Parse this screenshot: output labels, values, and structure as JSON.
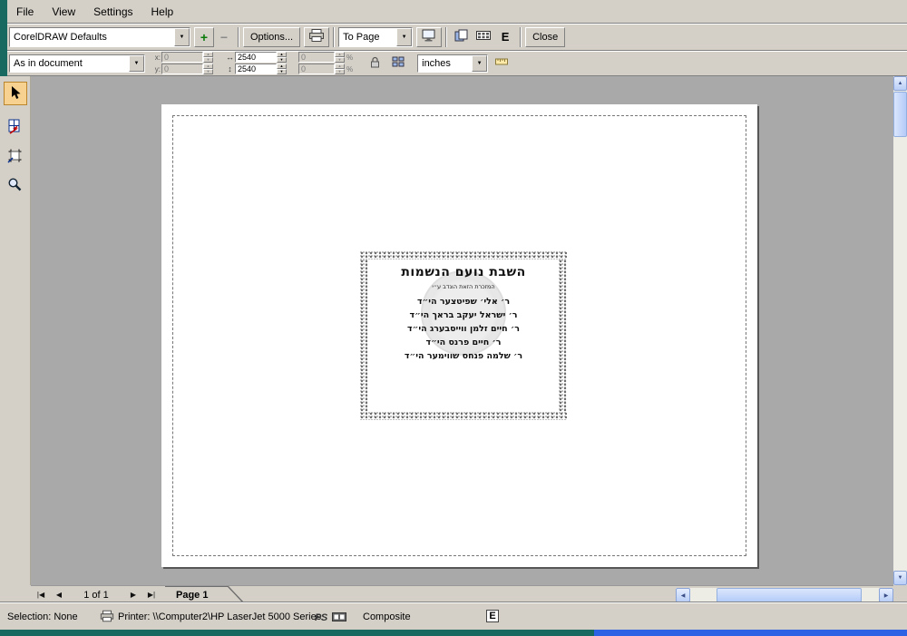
{
  "menu": {
    "items": [
      {
        "label": "File"
      },
      {
        "label": "View"
      },
      {
        "label": "Settings"
      },
      {
        "label": "Help"
      }
    ]
  },
  "toolbar": {
    "style_preset": "CorelDRAW Defaults",
    "add_button": "+",
    "remove_button": "−",
    "options_button": "Options...",
    "zoom_combo": "To Page",
    "mirror_button": "E",
    "close_button": "Close"
  },
  "props_bar": {
    "position_combo": "As in document",
    "x_label": "x:",
    "y_label": "y:",
    "x_value": "0",
    "y_value": "0",
    "width_value": "2540",
    "height_value": "2540",
    "scale_x_value": "0",
    "scale_y_value": "0",
    "percent": "%",
    "units_combo": "inches"
  },
  "icons": {
    "combo_arrow": "▼",
    "spin_up": "▲",
    "spin_down": "▼",
    "h_size": "↔",
    "v_size": "↕",
    "scroll_up": "▲",
    "scroll_down": "▼",
    "scroll_left": "◀",
    "scroll_right": "▶"
  },
  "page_nav": {
    "first": "|◀",
    "prev": "◀",
    "position": "1 of 1",
    "next": "▶",
    "last": "▶|",
    "tab_label": "Page 1"
  },
  "preview": {
    "title": "השבת נועם הנשמות",
    "dedication": "המזכרת הזאת הונדב ע״י",
    "names": [
      "ר׳ אלי׳ שפיטצער הי״ד",
      "ר׳ ישראל יעקב בראך הי״ד",
      "ר׳ חיים זלמן ווייסבערג הי״ד",
      "ר׳ חיים פרנס הי״ד",
      "ר׳ שלמה פנחס שווימער הי״ד"
    ]
  },
  "status_bar": {
    "selection": "Selection: None",
    "printer": "Printer: \\\\Computer2\\HP LaserJet 5000 Series",
    "ps_icon": "PS",
    "composite": "Composite",
    "e_icon": "E"
  }
}
